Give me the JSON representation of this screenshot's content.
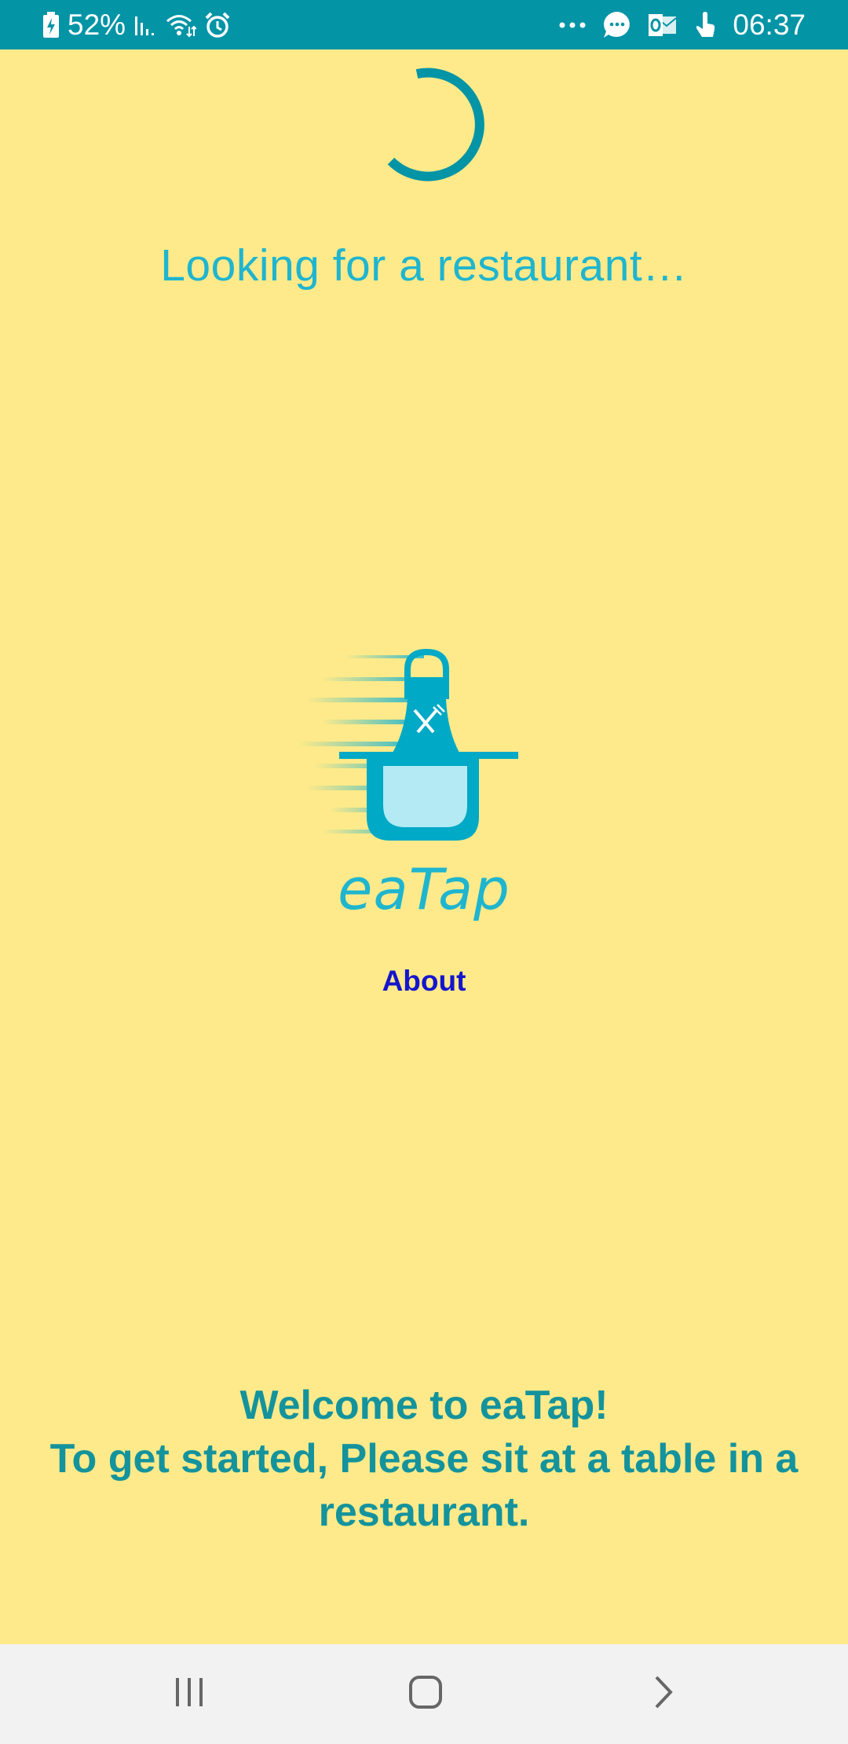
{
  "status_bar": {
    "battery": "52%",
    "time": "06:37",
    "bg_color": "#0394A6",
    "left_icons": [
      "battery-charging-icon",
      "signal-icon",
      "wifi-icon",
      "alarm-icon"
    ],
    "right_icons": [
      "more-dots-icon",
      "chat-bubble-icon",
      "outlook-icon",
      "touch-icon"
    ]
  },
  "loading": {
    "text": "Looking for a restaurant…"
  },
  "logo": {
    "icon": "apron-fork-knife-icon",
    "brand_name": "eaTap"
  },
  "about": {
    "label": "About"
  },
  "welcome": {
    "line1": "Welcome to eaTap!",
    "line2": "To get started, Please sit at a table in a restaurant."
  },
  "nav_bar": {
    "buttons": [
      "recent-apps-icon",
      "home-icon",
      "back-icon"
    ]
  },
  "colors": {
    "background": "#FEEA8A",
    "accent": "#1FB5CF",
    "dark_accent": "#0394A6",
    "welcome_text": "#14939C",
    "link": "#1515CF"
  }
}
